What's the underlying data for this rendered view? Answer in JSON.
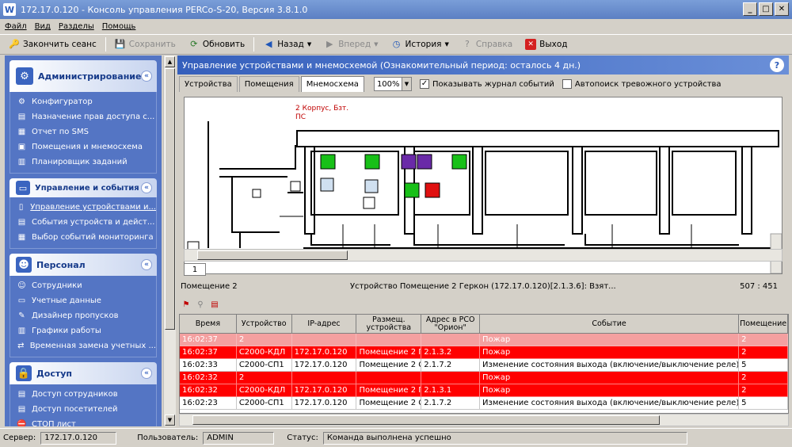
{
  "window": {
    "title": "172.17.0.120 - Консоль управления PERCo-S-20, Версия 3.8.1.0",
    "app_icon": "W"
  },
  "menu": [
    "Файл",
    "Вид",
    "Разделы",
    "Помощь"
  ],
  "toolbar": {
    "end_session": "Закончить сеанс",
    "save": "Сохранить",
    "refresh": "Обновить",
    "back": "Назад",
    "forward": "Вперед",
    "history": "История",
    "help": "Справка",
    "exit": "Выход"
  },
  "sidebar": {
    "admin": {
      "title": "Администрирование",
      "items": [
        "Конфигуратор",
        "Назначение прав доступа с...",
        "Отчет по SMS",
        "Помещения и мнемосхема",
        "Планировщик заданий"
      ]
    },
    "devices": {
      "title": "Управление и события",
      "items": [
        "Управление устройствами и...",
        "События устройств и дейст...",
        "Выбор событий мониторинга"
      ]
    },
    "staff": {
      "title": "Персонал",
      "items": [
        "Сотрудники",
        "Учетные данные",
        "Дизайнер пропусков",
        "Графики работы",
        "Временная замена учетных ..."
      ]
    },
    "access": {
      "title": "Доступ",
      "items": [
        "Доступ сотрудников",
        "Доступ посетителей",
        "СТОП лист"
      ]
    }
  },
  "main": {
    "header": "Управление устройствами и мнемосхемой (Ознакомительный период: осталось 4 дн.)",
    "tabs": [
      "Устройства",
      "Помещения",
      "Мнемосхема"
    ],
    "zoom": "100%",
    "show_log_label": "Показывать журнал событий",
    "autosearch_label": "Автопоиск тревожного устройства",
    "map_label_1": "2 Корпус, Бзт.",
    "map_label_2": "ПС",
    "page_tab": "1",
    "room_info": "Помещение 2",
    "device_info": "Устройство Помещение 2 Геркон (172.17.0.120)[2.1.3.6]: Взят...",
    "coords": "507 : 451"
  },
  "table": {
    "headers": [
      "Время",
      "Устройство",
      "IP-адрес",
      "Размещ. устройства",
      "Адрес в РСО \"Орион\"",
      "Событие",
      "Помещение"
    ],
    "rows": [
      {
        "style": "pink",
        "cells": [
          "16:02:37",
          "2",
          "",
          "",
          "",
          "Пожар",
          "2"
        ]
      },
      {
        "style": "red",
        "cells": [
          "16:02:37",
          "С2000-КДЛ",
          "172.17.0.120",
          "Помещение 2 Г",
          "2.1.3.2",
          "Пожар",
          "2"
        ]
      },
      {
        "style": "white",
        "cells": [
          "16:02:33",
          "С2000-СП1",
          "172.17.0.120",
          "Помещение 2 С",
          "2.1.7.2",
          "Изменение состояния выхода (включение/выключение реле)",
          "5"
        ]
      },
      {
        "style": "red",
        "cells": [
          "16:02:32",
          "2",
          "",
          "",
          "",
          "Пожар",
          "2"
        ]
      },
      {
        "style": "red",
        "cells": [
          "16:02:32",
          "С2000-КДЛ",
          "172.17.0.120",
          "Помещение 2 Г",
          "2.1.3.1",
          "Пожар",
          "2"
        ]
      },
      {
        "style": "white",
        "cells": [
          "16:02:23",
          "С2000-СП1",
          "172.17.0.120",
          "Помещение 2 С",
          "2.1.7.2",
          "Изменение состояния выхода (включение/выключение реле)",
          "5"
        ]
      }
    ]
  },
  "statusbar": {
    "server_label": "Сервер:",
    "server": "172.17.0.120",
    "user_label": "Пользователь:",
    "user": "ADMIN",
    "status_label": "Статус:",
    "status": "Команда выполнена успешно"
  }
}
